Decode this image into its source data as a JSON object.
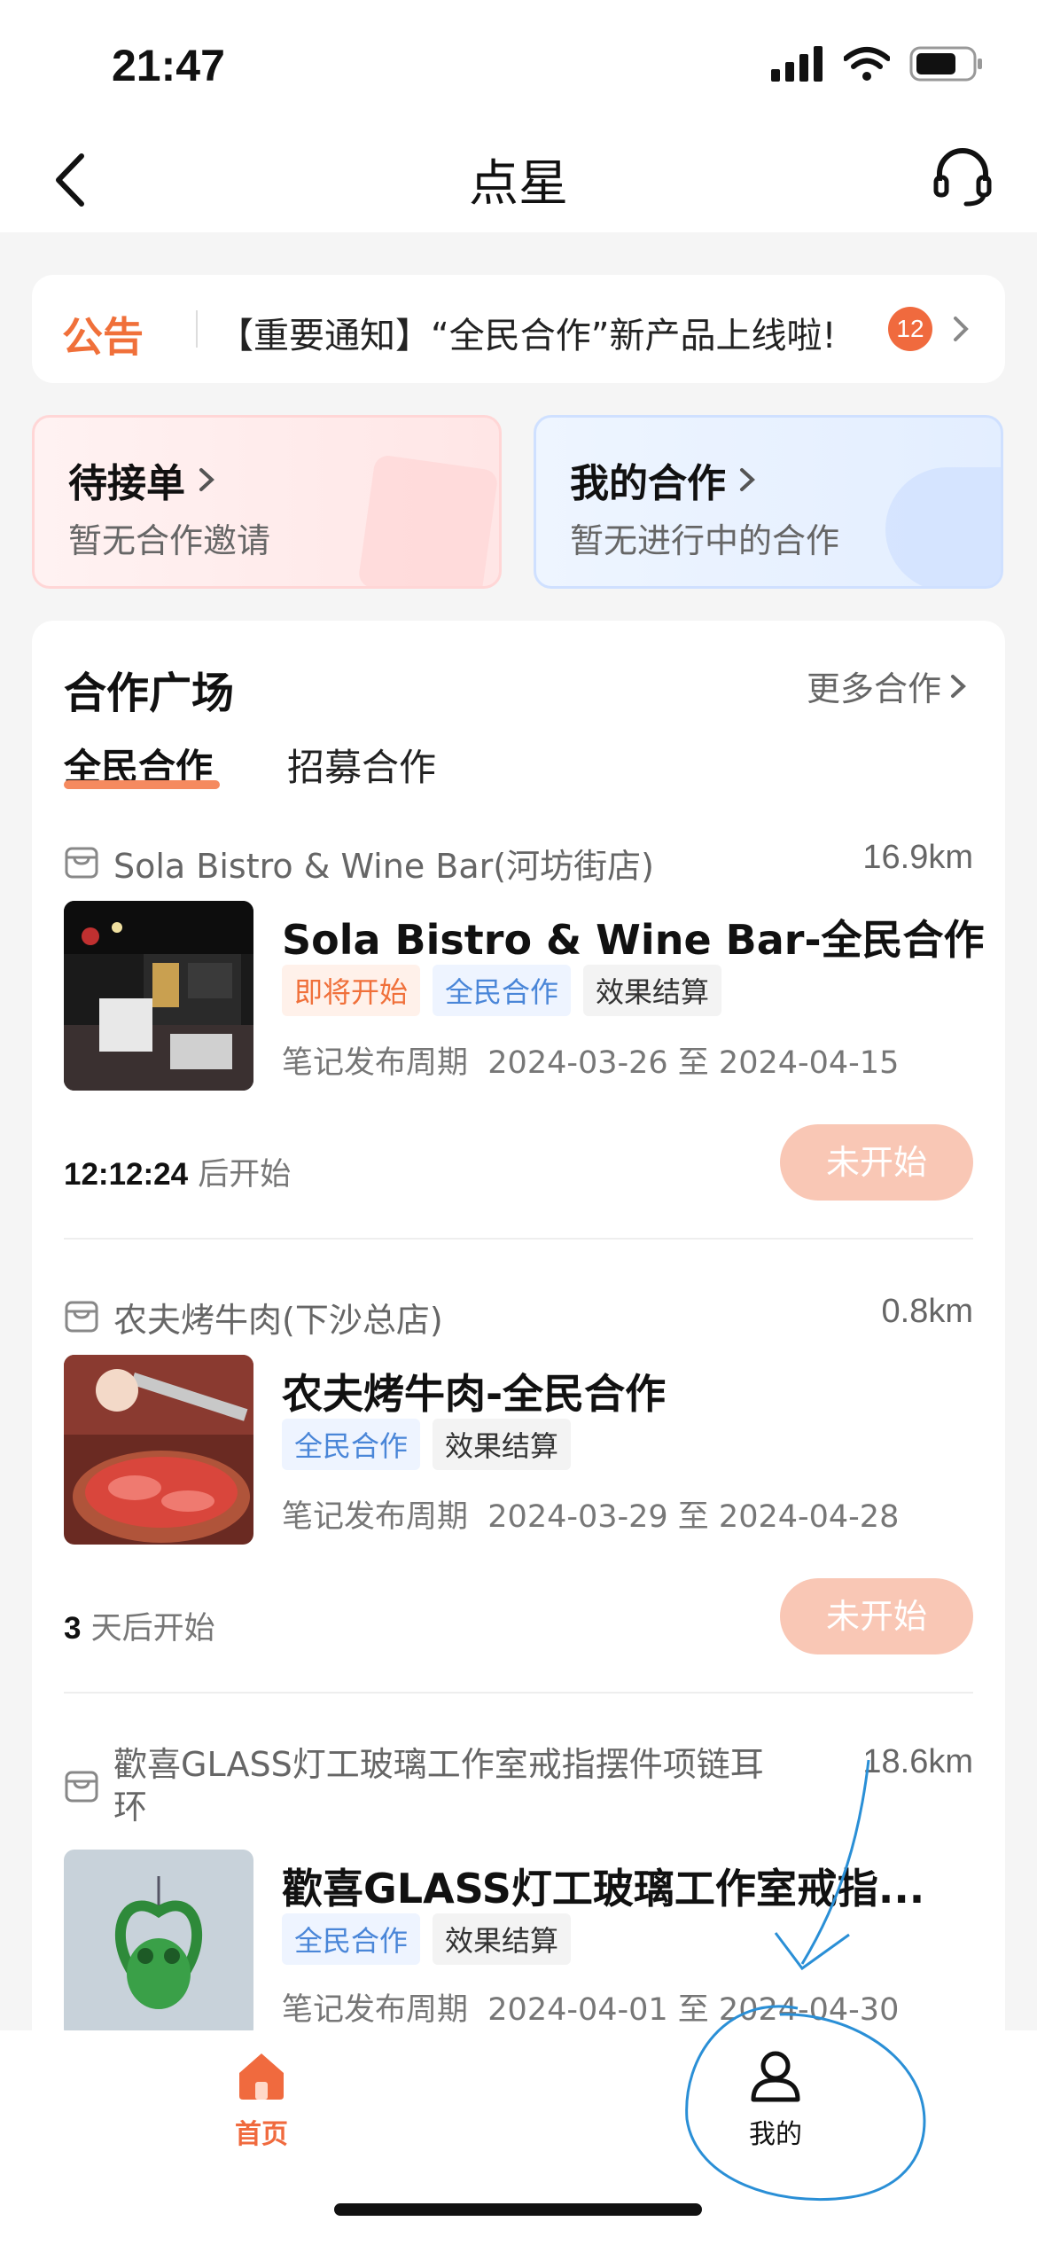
{
  "status_bar": {
    "time": "21:47"
  },
  "nav": {
    "title": "点星"
  },
  "notice": {
    "tag": "公告",
    "text": "【重要通知】“全民合作”新产品上线啦!",
    "badge": "12"
  },
  "cards": {
    "pending": {
      "title": "待接单",
      "subtitle": "暂无合作邀请"
    },
    "mine": {
      "title": "我的合作",
      "subtitle": "暂无进行中的合作"
    }
  },
  "plaza": {
    "title": "合作广场",
    "more": "更多合作",
    "tabs": [
      "全民合作",
      "招募合作"
    ],
    "items": [
      {
        "store": "Sola Bistro & Wine Bar(河坊街店)",
        "distance": "16.9km",
        "title": "Sola Bistro & Wine Bar-全民合作",
        "tags": [
          "即将开始",
          "全民合作",
          "效果结算"
        ],
        "period_label": "笔记发布周期",
        "period": "2024-03-26 至 2024-04-15",
        "countdown_value": "12:12:24",
        "countdown_suffix": "后开始",
        "button": "未开始"
      },
      {
        "store": "农夫烤牛肉(下沙总店)",
        "distance": "0.8km",
        "title": "农夫烤牛肉-全民合作",
        "tags": [
          "全民合作",
          "效果结算"
        ],
        "period_label": "笔记发布周期",
        "period": "2024-03-29 至 2024-04-28",
        "countdown_value": "3",
        "countdown_suffix": "天后开始",
        "button": "未开始"
      },
      {
        "store_line1": "歡喜GLASS灯工玻璃工作室戒指摆件项链耳",
        "store_line2": "环",
        "distance": "18.6km",
        "title": "歡喜GLASS灯工玻璃工作室戒指...",
        "tags": [
          "全民合作",
          "效果结算"
        ],
        "period_label": "笔记发布周期",
        "period": "2024-04-01 至 2024-04-30"
      }
    ]
  },
  "tabbar": {
    "home": "首页",
    "me": "我的"
  },
  "colors": {
    "accent": "#f06a3e",
    "blue_tag": "#4a86d8",
    "annotation": "#2a8fd6"
  }
}
